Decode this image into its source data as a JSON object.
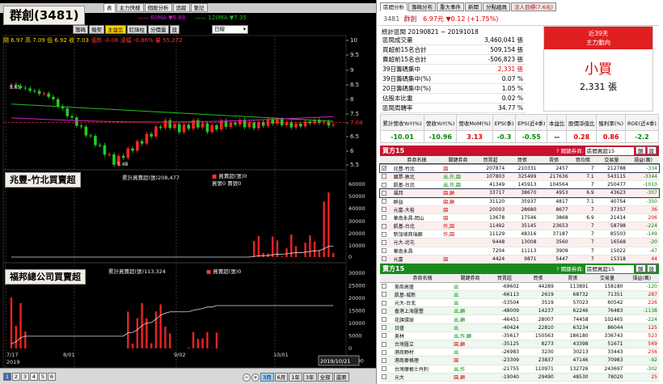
{
  "callouts": {
    "stock": "群創(3481)",
    "broker1": "兆豐-竹北買賣超",
    "broker2": "福邦總公司買賣超"
  },
  "chart": {
    "tabs": [
      "技術分析",
      "主力進出",
      "主力快搜",
      "個股分析",
      "追蹤",
      "筆記"
    ],
    "tabs_visible": [
      "表",
      "主力快搜",
      "個股分析",
      "追蹤",
      "筆記"
    ],
    "ma_legend": [
      {
        "label": "60MA ▼6.88",
        "color": "#d020d0"
      },
      {
        "label": "120MA ▼7.35",
        "color": "#20c020"
      }
    ],
    "tool_buttons": [
      "籌碼",
      "撥契",
      "主益比",
      "紅綠柱",
      "分價量",
      "設"
    ],
    "highlight_button": "主益比",
    "period": "日線",
    "ohlc": "開 6.97  高 7.09  低 6.92  收 7.03",
    "change": "漲跌 -0.06  漲幅 -0.86%  量 55,272",
    "price_ticks": [
      "10",
      "9.5",
      "9",
      "8.5",
      "8",
      "7.5",
      "7.04",
      "6.5",
      "6",
      "5.5"
    ],
    "current_price": "7.04",
    "high_label": "8.65",
    "low_label": "5.48",
    "pane1_legend1": "累計買賣超(張)208,477",
    "pane1_legend2": "買賣超(張)0",
    "pane1_legend3": "買張0 賣張0",
    "pane1_ticks": [
      "60000",
      "50000",
      "40000",
      "30000",
      "20000",
      "10000",
      "0"
    ],
    "pane2_legend1": "累計買賣超(張)113,324",
    "pane2_legend2": "買賣超(張)0",
    "pane2_ticks": [
      "30000",
      "25000",
      "20000",
      "15000",
      "10000",
      "5000",
      "0",
      "-5000"
    ],
    "x_labels": [
      "7/17",
      "8/01",
      "9/02",
      "10/01"
    ],
    "year_label": "2019",
    "date_end": "2019/10/21",
    "pages": [
      "1",
      "2",
      "3",
      "4",
      "5",
      "6"
    ],
    "period_buttons": [
      "3月",
      "6月",
      "1年",
      "3年",
      "全部",
      "還原"
    ]
  },
  "right": {
    "tabs": [
      "區間分析",
      "籌碼分布",
      "重大事件",
      "新聞",
      "分點組員",
      "法人目標(7.6元)"
    ],
    "code": "3481",
    "name": "群創",
    "quote": "6.97元 ▼0.12 (+1.75%)",
    "period": "統計區間 20190821 ~ 20191018",
    "stats": [
      {
        "label": "區間成交量",
        "value": "3,460,041 張",
        "color": "#000"
      },
      {
        "label": "買超前15名合計",
        "value": "509,154 張",
        "color": "#000"
      },
      {
        "label": "賣超前15名合計",
        "value": "-506,823 張",
        "color": "#000"
      },
      {
        "label": "39日籌碼集中",
        "value": "2,331 張",
        "color": "#d00"
      },
      {
        "label": "39日籌碼集中(%)",
        "value": "0.07 %",
        "color": "#000"
      },
      {
        "label": "20日籌碼集中(%)",
        "value": "1.05 %",
        "color": "#000"
      },
      {
        "label": "佔股本比重",
        "value": "0.02 %",
        "color": "#000"
      },
      {
        "label": "區間周轉率",
        "value": "34.77 %",
        "color": "#000"
      }
    ],
    "main_head1": "近39天",
    "main_head2": "主力動向",
    "main_status": "小買",
    "main_value": "2,331 張",
    "kpi_heads": [
      "累計營收YoY(%)",
      "營收YoY(%)",
      "營收MoM(%)",
      "EPS(季)",
      "EPS(近4季)",
      "本益比",
      "股價淨值比",
      "殖利率(%)",
      "ROE(近4季)"
    ],
    "kpi_values": [
      {
        "v": "-10.01",
        "c": "#080"
      },
      {
        "v": "-10.96",
        "c": "#080"
      },
      {
        "v": "3.13",
        "c": "#d00"
      },
      {
        "v": "-0.3",
        "c": "#080"
      },
      {
        "v": "-0.55",
        "c": "#080"
      },
      {
        "v": "--",
        "c": "#000"
      },
      {
        "v": "0.28",
        "c": "#d00"
      },
      {
        "v": "0.86",
        "c": "#d00"
      },
      {
        "v": "-2.2",
        "c": "#080"
      }
    ],
    "buy_title": "買方15",
    "sell_title": "賣方15",
    "filter_label": "? 關鍵券商:",
    "filter_value": "區間買超15",
    "filter_btns": [
      "鎖",
      "設"
    ],
    "buy_heads": [
      "券商名稱",
      "關鍵券商",
      "買賣超",
      "買張",
      "賣張",
      "買均價",
      "交易量",
      "損益(萬)"
    ],
    "buy_rows": [
      {
        "n": "兆豐-竹北",
        "k": "園",
        "net": "207874",
        "b": "210331",
        "s": "2457",
        "p": "7",
        "v": "212788",
        "pl": "-334",
        "checked": true,
        "hl": true
      },
      {
        "n": "國票-敦北",
        "k": "出,作,園",
        "net": "107803",
        "b": "325499",
        "s": "217636",
        "p": "7.1",
        "v": "543115",
        "pl": "-3344"
      },
      {
        "n": "凱基-台北",
        "k": "出,作,園",
        "net": "41349",
        "b": "145913",
        "s": "104564",
        "p": "7",
        "v": "250477",
        "pl": "-1010"
      },
      {
        "n": "福邦",
        "k": "園,顧",
        "net": "33717",
        "b": "38670",
        "s": "4953",
        "p": "6.9",
        "v": "43623",
        "pl": "-307",
        "hl": true
      },
      {
        "n": "群益",
        "k": "園,顧",
        "net": "31120",
        "b": "35937",
        "s": "4817",
        "p": "7.1",
        "v": "40754",
        "pl": "-350"
      },
      {
        "n": "元富-大裕",
        "k": "園",
        "net": "20003",
        "b": "28680",
        "s": "8677",
        "p": "7",
        "v": "37357",
        "pl": "36"
      },
      {
        "n": "華南永昌-岡山",
        "k": "園",
        "net": "13678",
        "b": "17546",
        "s": "3868",
        "p": "6.9",
        "v": "21414",
        "pl": "206"
      },
      {
        "n": "凱基-台北",
        "k": "作,園",
        "net": "11492",
        "b": "35145",
        "s": "23653",
        "p": "7",
        "v": "58798",
        "pl": "-224"
      },
      {
        "n": "新加坡商瑞銀",
        "k": "作,園",
        "net": "11129",
        "b": "48316",
        "s": "37187",
        "p": "7",
        "v": "85503",
        "pl": "-149"
      },
      {
        "n": "元大-北屯",
        "k": "",
        "net": "9448",
        "b": "13008",
        "s": "3560",
        "p": "7",
        "v": "16568",
        "pl": "-20"
      },
      {
        "n": "華南永昌",
        "k": "",
        "net": "7204",
        "b": "11113",
        "s": "3909",
        "p": "7",
        "v": "15022",
        "pl": "-47"
      },
      {
        "n": "元富",
        "k": "園",
        "net": "4424",
        "b": "9871",
        "s": "5447",
        "p": "7",
        "v": "15318",
        "pl": "44"
      }
    ],
    "sell_heads": [
      "券商名稱",
      "關鍵券商",
      "買賣超",
      "買張",
      "賣張",
      "交易量",
      "損益(萬)"
    ],
    "sell_rows": [
      {
        "n": "美商高盛",
        "k": "出",
        "net": "-69602",
        "b": "44289",
        "s": "113891",
        "v": "158180",
        "pl": "-120"
      },
      {
        "n": "凱基-城新",
        "k": "出",
        "net": "-66113",
        "b": "2619",
        "s": "68732",
        "v": "71351",
        "pl": "287"
      },
      {
        "n": "元大-台北",
        "k": "出",
        "net": "-53504",
        "b": "3519",
        "s": "57023",
        "v": "60542",
        "pl": "226"
      },
      {
        "n": "香港上海匯豐",
        "k": "出,顧",
        "net": "-48009",
        "b": "14237",
        "s": "62246",
        "v": "76483",
        "pl": "-1138"
      },
      {
        "n": "花旗環球",
        "k": "出,顧",
        "net": "-46451",
        "b": "28007",
        "s": "74458",
        "v": "102465",
        "pl": "-224"
      },
      {
        "n": "日盛",
        "k": "出",
        "net": "-40424",
        "b": "22810",
        "s": "63234",
        "v": "86044",
        "pl": "125"
      },
      {
        "n": "美林",
        "k": "出,作,顧",
        "net": "-35617",
        "b": "150563",
        "s": "186180",
        "v": "336743",
        "pl": "523"
      },
      {
        "n": "台灣匯立",
        "k": "園,顧",
        "net": "-35125",
        "b": "8273",
        "s": "43398",
        "v": "51671",
        "pl": "569"
      },
      {
        "n": "港商野村",
        "k": "出",
        "net": "-26983",
        "b": "3230",
        "s": "30213",
        "v": "33443",
        "pl": "256"
      },
      {
        "n": "港商麥格理",
        "k": "園",
        "net": "-23309",
        "b": "23837",
        "s": "47146",
        "v": "70983",
        "pl": "-92"
      },
      {
        "n": "台灣摩根士丹利",
        "k": "出,作",
        "net": "-21755",
        "b": "110971",
        "s": "132726",
        "v": "243697",
        "pl": "-302"
      },
      {
        "n": "元大",
        "k": "園,顧",
        "net": "-19040",
        "b": "29490",
        "s": "48530",
        "v": "78020",
        "pl": "25"
      }
    ]
  }
}
